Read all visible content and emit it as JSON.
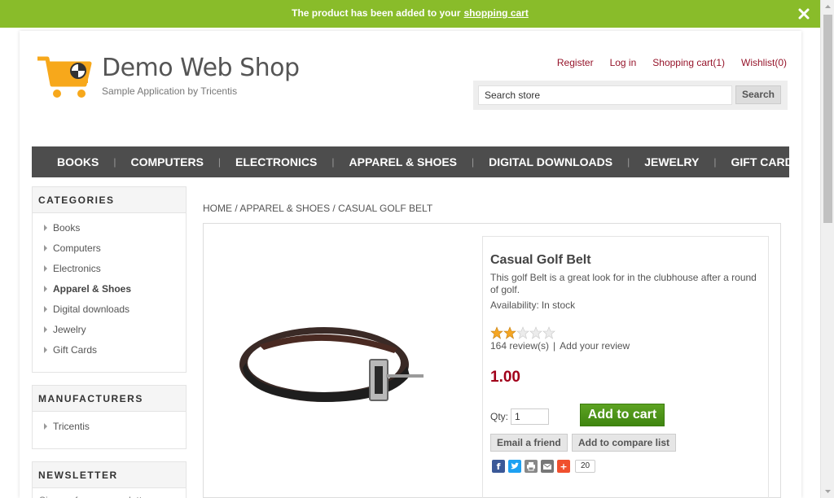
{
  "notification": {
    "text": "The product has been added to your",
    "link": "shopping cart"
  },
  "header": {
    "title": "Demo Web Shop",
    "subtitle": "Sample Application by Tricentis",
    "links": {
      "register": "Register",
      "login": "Log in",
      "cart": "Shopping cart(1)",
      "wishlist": "Wishlist(0)"
    },
    "search": {
      "value": "Search store",
      "button": "Search"
    }
  },
  "nav": [
    "BOOKS",
    "COMPUTERS",
    "ELECTRONICS",
    "APPAREL & SHOES",
    "DIGITAL DOWNLOADS",
    "JEWELRY",
    "GIFT CARDS"
  ],
  "categories": {
    "title": "CATEGORIES",
    "items": [
      "Books",
      "Computers",
      "Electronics",
      "Apparel & Shoes",
      "Digital downloads",
      "Jewelry",
      "Gift Cards"
    ]
  },
  "manufacturers": {
    "title": "MANUFACTURERS",
    "items": [
      "Tricentis"
    ]
  },
  "newsletter": {
    "title": "NEWSLETTER",
    "text": "Sign up for our newsletter:"
  },
  "breadcrumb": {
    "home": "HOME",
    "category": "APPAREL & SHOES",
    "current": "CASUAL GOLF BELT",
    "sep": "/"
  },
  "product": {
    "name": "Casual Golf Belt",
    "description": "This golf Belt is a great look for in the clubhouse after a round of golf.",
    "availability_label": "Availability:",
    "availability_value": "In stock",
    "rating": 2,
    "rating_max": 5,
    "reviews": "164 review(s)",
    "add_review": "Add your review",
    "price": "1.00",
    "qty_label": "Qty:",
    "qty_value": "1",
    "add_to_cart": "Add to cart",
    "email_friend": "Email a friend",
    "compare": "Add to compare list",
    "share_count": "20"
  },
  "colors": {
    "notify_bg": "#89bc2a",
    "link": "#96152b",
    "nav_bg": "#4d4d4d",
    "price": "#a1001a",
    "cart_btn": "#519a1b"
  }
}
